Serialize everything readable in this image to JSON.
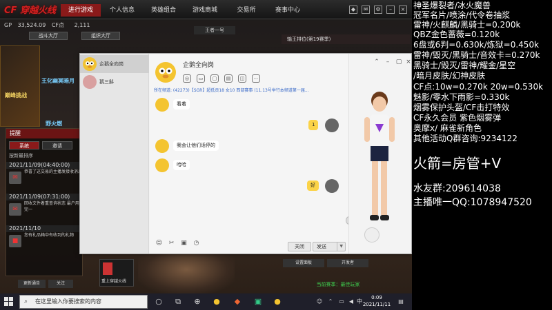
{
  "game": {
    "logo": "CF 穿越火线",
    "nav": [
      "进行游戏",
      "个人信息",
      "英雄组合",
      "游戏商城",
      "交易所",
      "赛事中心"
    ],
    "gp_label": "GP",
    "gp_value": "33,524.09",
    "cf_label": "CF点",
    "cf_value": "",
    "count_value": "2,111",
    "tabs": [
      "战斗大厅",
      "组织大厅"
    ],
    "center_label": "王者一号",
    "right_mini": "输王排位(第19赛季)",
    "banners": [
      "巅峰挑战",
      "王化幽冥暗月",
      "好",
      "野火燃"
    ],
    "left_panel": {
      "title": "提醒",
      "tabs": [
        "系统",
        "邀请"
      ],
      "sort_label": "按新最排序",
      "messages": [
        {
          "date": "2021/11/09(04:40:00)",
          "text": "恭喜了这交易的主播发接收消息"
        },
        {
          "date": "2021/11/09(07:31:00)",
          "text": "回收文件着重查询状态 最户用完一"
        },
        {
          "date": "2021/11/10",
          "text": "您有礼品箱中有收到的礼物"
        }
      ]
    },
    "bottom_buttons": [
      "更新通告",
      "关注",
      "设置面板",
      "开发者"
    ],
    "fire_tile": "重上穿越火线",
    "green_label": "当前赛季：最佳玩家"
  },
  "chat": {
    "contacts": [
      {
        "name": "企鹅全向岗",
        "selected": true
      },
      {
        "name": "鹅三斛",
        "selected": false
      }
    ],
    "title": "企鹅全向岗",
    "notice": "所在频道: (42273)【SGR】超低贡18 女10 西部赛事  (11.13号举行本频道第一届...",
    "messages": [
      {
        "from": "bot",
        "text": "看着"
      },
      {
        "from": "me",
        "text": "1"
      },
      {
        "from": "bot",
        "text": "我会让他们话停的"
      },
      {
        "from": "bot",
        "text": "哈哈"
      },
      {
        "from": "me",
        "text": "好"
      }
    ],
    "close_label": "关闭",
    "send_label": "发送"
  },
  "overlay": {
    "lines": [
      "神圣爆裂者/冰火魔兽",
      "冠军名片/喷涂/代令卷抽浆",
      "雷神/火麒麟/黑骑士=0.200k",
      "QBZ金色蔷薇=0.120k",
      "6盘或6判=0.630k/炼狱=0.450k",
      "雷神/毁灭/黑骑士/音效卡=0.270k",
      "黑骑士/毁灭/雷神/耀金/星空",
      "/暗月皮肤/幻神皮肤",
      "CF点:10w=0.270k  20w=0.530k",
      "魅影/零水下雨影=0.330k",
      "烟雾保护头盔/CF击打特效",
      " CF永久会员  紫色烟雾弹",
      "奥摩x/   麻雀新角色",
      "其他活动Q群咨询:9234122"
    ],
    "big": "火箭=房管+V",
    "group": "水友群:209614038",
    "qq": "主播唯一QQ:1078947520"
  },
  "taskbar": {
    "search_placeholder": "在这里输入你要搜索的内容",
    "time": "0:09",
    "date": "2021/11/11",
    "lang": "中"
  }
}
